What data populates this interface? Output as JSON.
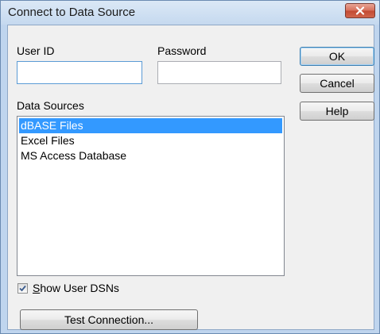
{
  "window": {
    "title": "Connect to Data Source",
    "close_icon": "close-icon"
  },
  "form": {
    "user_id_label": "User ID",
    "user_id_value": "",
    "password_label": "Password",
    "password_value": "",
    "data_sources_label": "Data Sources"
  },
  "data_sources": [
    {
      "label": "dBASE Files",
      "selected": true
    },
    {
      "label": "Excel Files",
      "selected": false
    },
    {
      "label": "MS Access Database",
      "selected": false
    }
  ],
  "show_user_dsns": {
    "accel": "S",
    "rest": "how User DSNs",
    "checked": true
  },
  "buttons": {
    "ok": "OK",
    "cancel": "Cancel",
    "help": "Help",
    "test_connection": "Test Connection..."
  },
  "colors": {
    "selection": "#3399ff",
    "frame": "#bfd5ee",
    "close_button": "#c7503a"
  }
}
